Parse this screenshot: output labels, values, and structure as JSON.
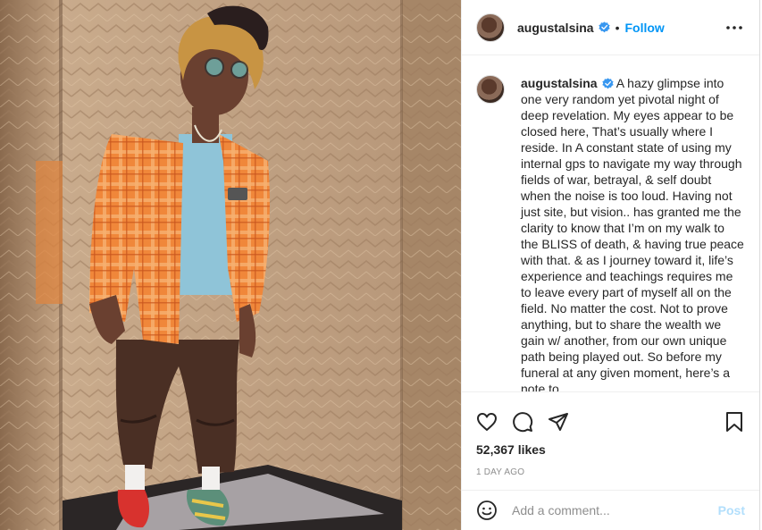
{
  "post": {
    "username": "augustalsina",
    "verified": true,
    "follow_label": "Follow",
    "separator": "•",
    "caption": "A hazy glimpse into one very random yet pivotal night of deep revelation. My eyes appear to be closed here, That’s usually where I reside. In A constant state of using my internal gps to navigate my way through fields of war, betrayal, & self doubt when the noise is too loud. Having not just site, but vision.. has granted me the clarity to know that I’m on my walk to the BLISS of death, & having true peace with that. & as I journey toward it, life’s experience and teachings requires me to leave every part of myself all on the field. No matter the cost. Not to prove anything, but to share the wealth we gain w/ another, from our own unique path being played out. So before my funeral at any given moment, here’s a note to",
    "likes": "52,367 likes",
    "time_ago": "1 DAY AGO"
  },
  "comment": {
    "placeholder": "Add a comment...",
    "post_label": "Post"
  },
  "icons": {
    "more": "more-options-icon",
    "like": "heart-icon",
    "comment": "comment-icon",
    "share": "share-icon",
    "save": "bookmark-icon",
    "emoji": "emoji-icon",
    "verified": "verified-badge-icon"
  },
  "colors": {
    "accent": "#0095f6",
    "post_disabled": "#b2dffc",
    "muted": "#8e8e8e",
    "text": "#262626"
  }
}
